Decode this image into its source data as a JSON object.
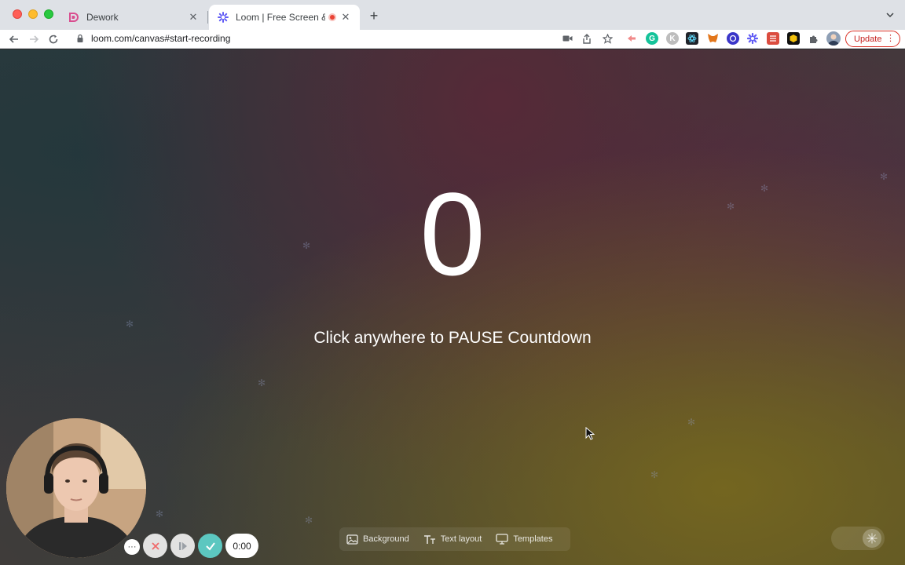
{
  "window": {
    "traffic_lights": [
      "close",
      "minimize",
      "zoom"
    ]
  },
  "tabs": [
    {
      "title": "Dework",
      "favicon": "dework-icon",
      "active": false
    },
    {
      "title": "Loom | Free Screen & Vide",
      "favicon": "loom-icon",
      "active": true,
      "recording": true
    }
  ],
  "toolbar": {
    "url": "loom.com/canvas#start-recording",
    "update_label": "Update"
  },
  "extensions": [
    "video-camera-icon",
    "share-icon",
    "star-icon",
    "loom-ext-icon",
    "grammarly-icon",
    "k-ext-icon",
    "react-devtools-icon",
    "metamask-icon",
    "circle-ext-icon",
    "loom-snowflake-icon",
    "todoist-icon",
    "hex-ext-icon",
    "puzzle-icon"
  ],
  "canvas": {
    "countdown_value": "0",
    "countdown_message": "Click anywhere to PAUSE Countdown"
  },
  "recorder": {
    "more_label": "···",
    "timer": "0:00"
  },
  "canvas_tools": {
    "background_label": "Background",
    "text_layout_label": "Text layout",
    "templates_label": "Templates"
  },
  "colors": {
    "update_red": "#c5221f",
    "done_teal": "#5cc7c0",
    "cancel_red": "#e24c4c"
  }
}
